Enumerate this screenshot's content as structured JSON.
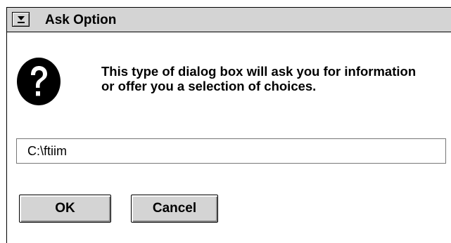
{
  "window": {
    "title": "Ask Option",
    "system_menu_icon": "system-menu-arrow-icon"
  },
  "dialog": {
    "icon": "question-icon",
    "message": "This type of dialog box will ask you for information or offer you a selection of choices.",
    "input": {
      "value": "C:\\ftiim"
    },
    "buttons": {
      "ok_label": "OK",
      "cancel_label": "Cancel"
    }
  }
}
